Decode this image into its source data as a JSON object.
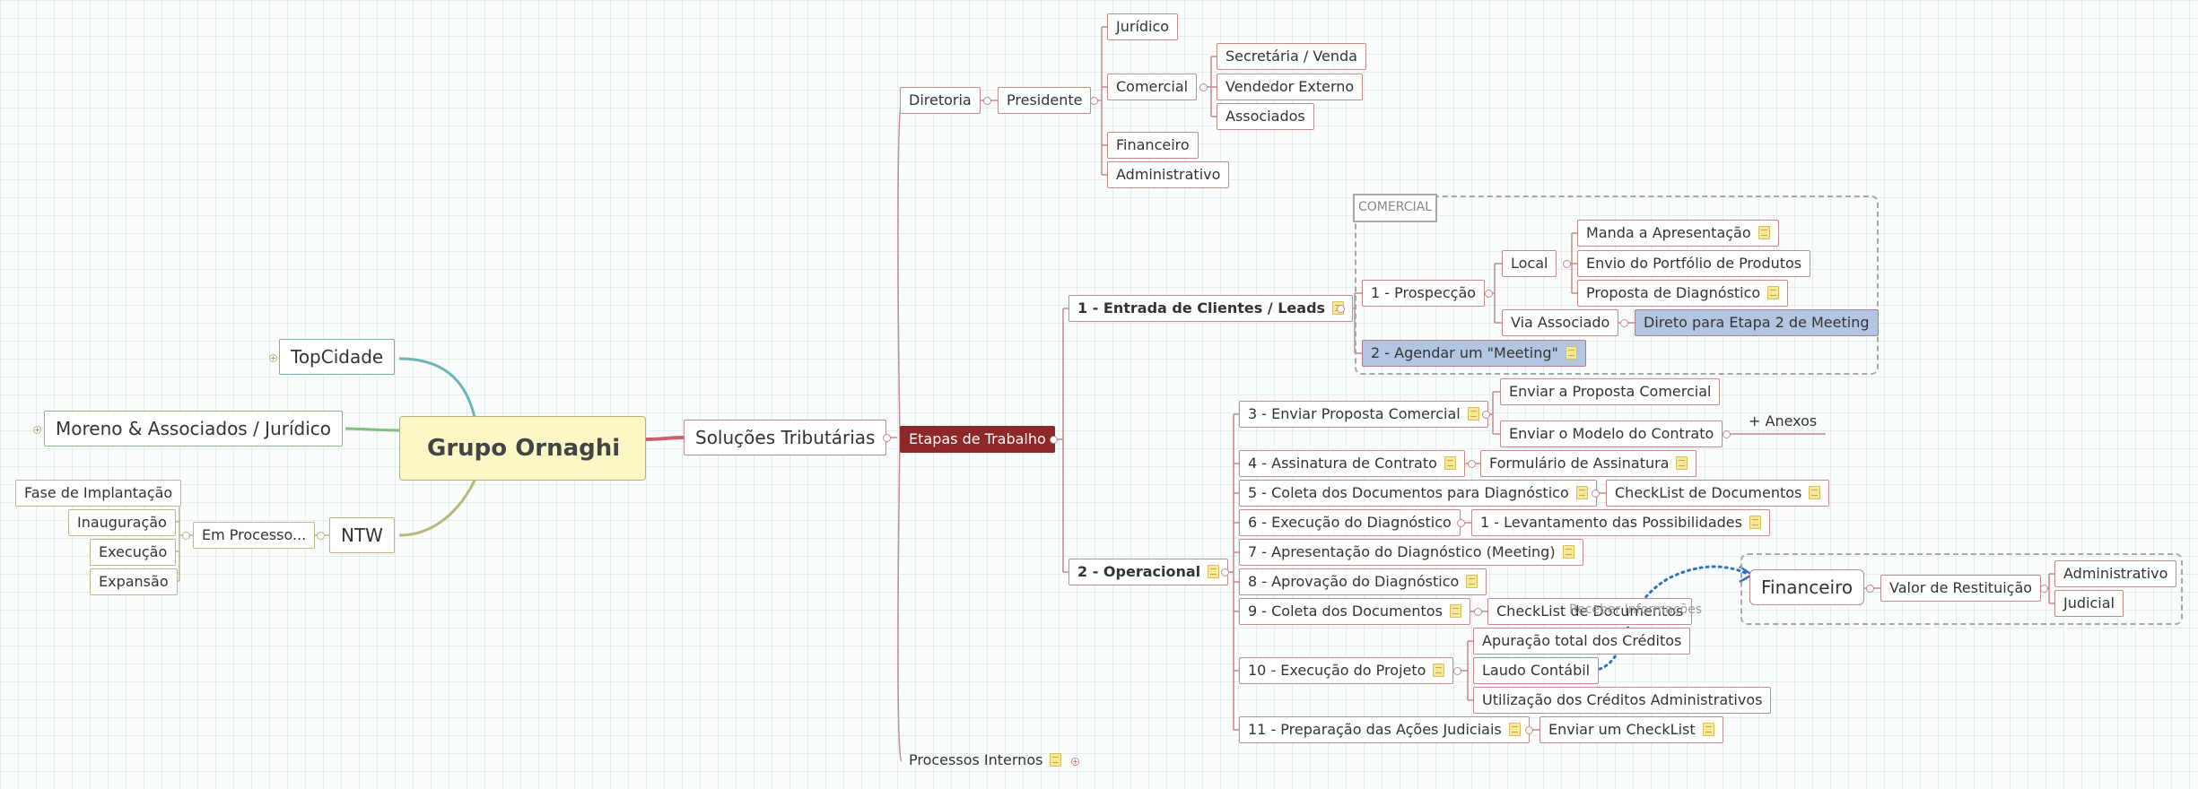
{
  "root": "Grupo Ornaghi",
  "left": {
    "topcidade": "TopCidade",
    "moreno": "Moreno & Associados / Jurídico",
    "ntw": "NTW",
    "em_processo": "Em Processo...",
    "fase": "Fase de Implantação",
    "inauguracao": "Inauguração",
    "execucao": "Execução",
    "expansao": "Expansão"
  },
  "solucoes": "Soluções Tributárias",
  "diretoria": {
    "label": "Diretoria",
    "presidente": "Presidente",
    "juridico": "Jurídico",
    "comercial": "Comercial",
    "secretaria": "Secretária / Venda",
    "vendedor": "Vendedor Externo",
    "associados": "Associados",
    "financeiro": "Financeiro",
    "administrativo": "Administrativo"
  },
  "etapas": "Etapas de Trabalho",
  "processos_internos": "Processos Internos",
  "boundary_title": "COMERCIAL",
  "entrada": {
    "label": "1 - Entrada de Clientes / Leads",
    "prospeccao": "1 - Prospecção",
    "local": "Local",
    "manda": "Manda a Apresentação",
    "envio": "Envio do Portfólio de Produtos",
    "proposta_diag": "Proposta de Diagnóstico",
    "via_associado": "Via Associado",
    "direto": "Direto para Etapa 2 de Meeting",
    "agendar": "2 - Agendar um \"Meeting\""
  },
  "operacional": {
    "label": "2 - Operacional",
    "s3": "3 - Enviar Proposta Comercial",
    "s3a": "Enviar a Proposta Comercial",
    "s3b": "Enviar o Modelo do Contrato",
    "anexos": "+ Anexos",
    "s4": "4 - Assinatura de Contrato",
    "s4a": "Formulário de Assinatura",
    "s5": "5 - Coleta dos Documentos para Diagnóstico",
    "s5a": "CheckList de Documentos",
    "s6": "6 - Execução do Diagnóstico",
    "s6a": "1 - Levantamento das Possibilidades",
    "s7": "7 - Apresentação do Diagnóstico (Meeting)",
    "s8": "8 - Aprovação do Diagnóstico",
    "s9": "9 - Coleta dos Documentos",
    "s9a": "CheckList de Documentos",
    "s10": "10 - Execução do Projeto",
    "s10a": "Apuração total dos Créditos",
    "s10b": "Laudo Contábil",
    "s10c": "Utilização dos Créditos Administrativos",
    "s11": "11 - Preparação das Ações Judiciais",
    "s11a": "Enviar um CheckList"
  },
  "relation_label": "Receber Informações",
  "financeiro_float": {
    "label": "Financeiro",
    "valor": "Valor de Restituição",
    "administrativo": "Administrativo",
    "judicial": "Judicial"
  }
}
